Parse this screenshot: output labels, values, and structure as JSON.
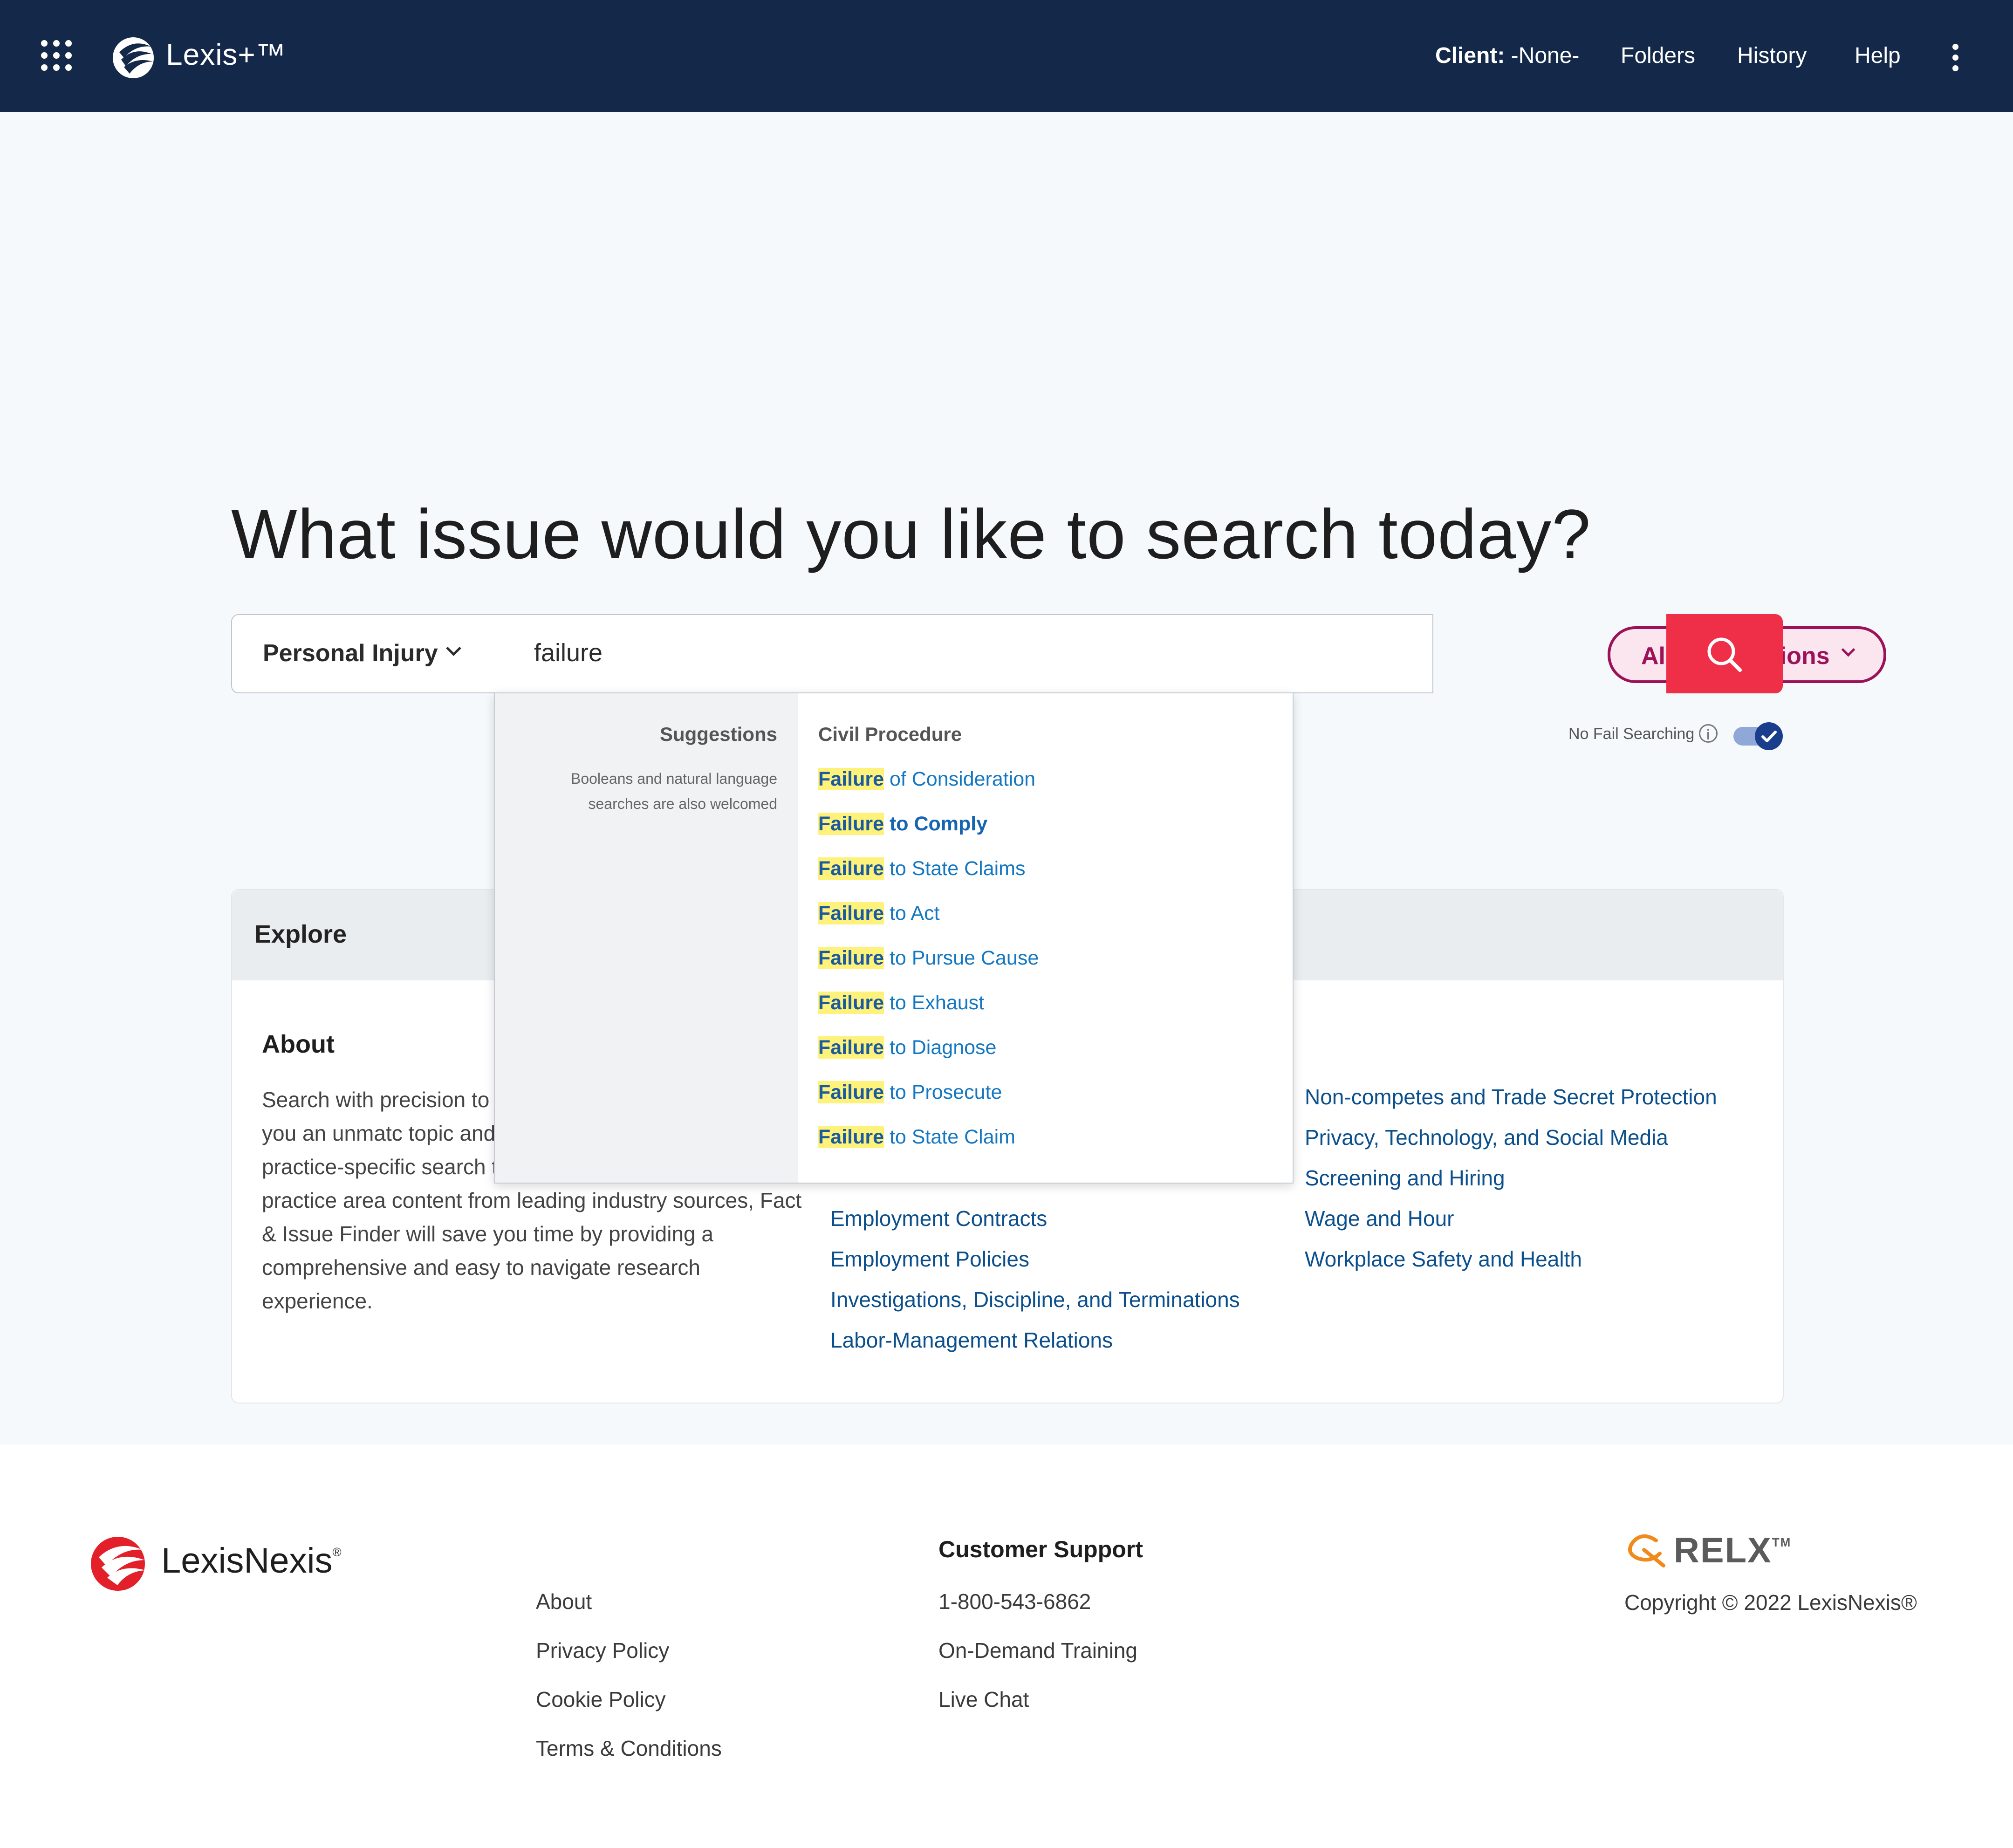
{
  "header": {
    "app_name": "Lexis+™",
    "client_label": "Client:",
    "client_value": "-None-",
    "nav": [
      "Folders",
      "History",
      "Help"
    ]
  },
  "search": {
    "headline": "What issue would you like to search today?",
    "practice_area": "Personal Injury",
    "query": "failure",
    "jurisdiction": "All Jurisdictions",
    "no_fail_label": "No Fail Searching",
    "no_fail_enabled": true
  },
  "dropdown": {
    "suggestions_title": "Suggestions",
    "suggestions_note": "Booleans and natural language searches are also welcomed",
    "category": "Civil Procedure",
    "items": [
      {
        "match": "Failure",
        "rest": " of Consideration"
      },
      {
        "match": "Failure",
        "rest": " to Comply"
      },
      {
        "match": "Failure",
        "rest": " to State Claims"
      },
      {
        "match": "Failure",
        "rest": " to Act"
      },
      {
        "match": "Failure",
        "rest": " to Pursue Cause"
      },
      {
        "match": "Failure",
        "rest": " to Exhaust"
      },
      {
        "match": "Failure",
        "rest": " to Diagnose"
      },
      {
        "match": "Failure",
        "rest": " to Prosecute"
      },
      {
        "match": "Failure",
        "rest": " to State Claim"
      }
    ]
  },
  "explore": {
    "title": "Explore",
    "about_title": "About",
    "about_text": "Search with precision to authoritative content fa provides you an unmatc topic and issue research. Enriched with practice-specific search taxonomies and authoritative practice area content from leading industry sources, Fact & Issue Finder will save you time by providing a comprehensive and easy to navigate research experience.",
    "topics_col2": [
      "Employment Contracts",
      "Employment Policies",
      "Investigations, Discipline, and Terminations",
      "Labor-Management Relations"
    ],
    "topics_col3": [
      "Non-competes and Trade Secret Protection",
      "Privacy, Technology, and Social Media",
      "Screening and Hiring",
      "Wage and Hour",
      "Workplace Safety and Health"
    ]
  },
  "footer": {
    "brand": "LexisNexis",
    "links": [
      "About",
      "Privacy Policy",
      "Cookie Policy",
      "Terms & Conditions"
    ],
    "support_title": "Customer Support",
    "support_links": [
      "1-800-543-6862",
      "On-Demand Training",
      "Live Chat"
    ],
    "relx": "RELX",
    "copyright": "Copyright © 2022 LexisNexis®"
  },
  "colors": {
    "header_bg": "#14294a",
    "search_button": "#ee2f47",
    "jurisdiction_accent": "#9c1258",
    "link": "#0b4f8c",
    "highlight": "#fff27a"
  }
}
